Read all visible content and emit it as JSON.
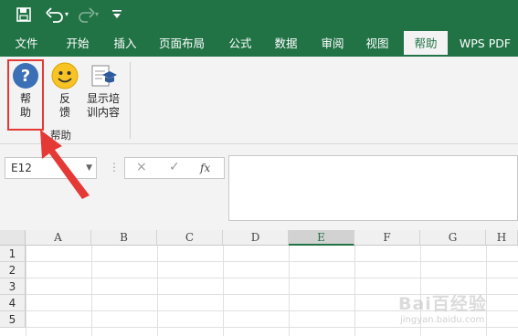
{
  "quick_access": {
    "save_icon": "save-icon",
    "undo_icon": "undo-icon",
    "redo_icon": "redo-icon",
    "customize_icon": "customize-qat-icon"
  },
  "tabs": [
    {
      "label": "文件"
    },
    {
      "label": "开始"
    },
    {
      "label": "插入"
    },
    {
      "label": "页面布局"
    },
    {
      "label": "公式"
    },
    {
      "label": "数据"
    },
    {
      "label": "审阅"
    },
    {
      "label": "视图"
    },
    {
      "label": "帮助",
      "active": true
    },
    {
      "label": "WPS PDF"
    }
  ],
  "ribbon": {
    "help_button": {
      "line1": "帮",
      "line2": "助"
    },
    "feedback_button": {
      "line1": "反",
      "line2": "馈"
    },
    "training_button": {
      "line1": "显示培",
      "line2": "训内容"
    },
    "group_label": "帮助"
  },
  "formula_bar": {
    "name_box": "E12",
    "cancel_icon": "×",
    "enter_icon": "✓",
    "fx_label": "fx",
    "formula_value": ""
  },
  "grid": {
    "columns": [
      "A",
      "B",
      "C",
      "D",
      "E",
      "F",
      "G",
      "H"
    ],
    "selected_column": "E",
    "rows": [
      "1",
      "2",
      "3",
      "4",
      "5"
    ]
  },
  "watermark": {
    "main": "Bai百经验",
    "sub": "jingyan.baidu.com"
  },
  "colors": {
    "excel_green": "#217346",
    "highlight_red": "#e53935",
    "help_icon_blue": "#3b6fb6",
    "feedback_yellow": "#f7c325"
  }
}
